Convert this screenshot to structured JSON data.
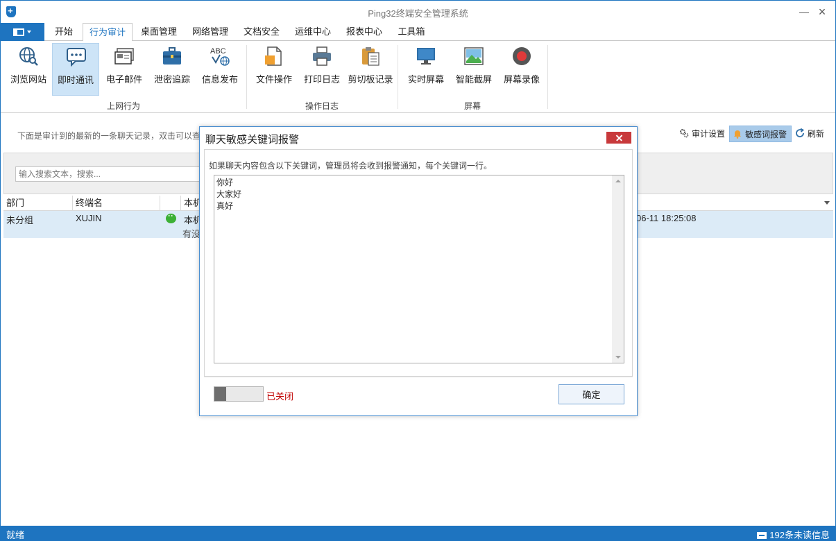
{
  "window": {
    "title": "Ping32终端安全管理系统"
  },
  "tabs": [
    {
      "label": "开始"
    },
    {
      "label": "行为审计",
      "active": true
    },
    {
      "label": "桌面管理"
    },
    {
      "label": "网络管理"
    },
    {
      "label": "文档安全"
    },
    {
      "label": "运维中心"
    },
    {
      "label": "报表中心"
    },
    {
      "label": "工具箱"
    }
  ],
  "ribbon": {
    "groups": [
      {
        "label": "上网行为"
      },
      {
        "label": "操作日志"
      },
      {
        "label": "屏幕"
      }
    ],
    "buttons": [
      {
        "label": "浏览网站",
        "icon": "globe-search-icon"
      },
      {
        "label": "即时通讯",
        "icon": "chat-bubble-icon",
        "selected": true
      },
      {
        "label": "电子邮件",
        "icon": "email-icon"
      },
      {
        "label": "泄密追踪",
        "icon": "briefcase-icon"
      },
      {
        "label": "信息发布",
        "icon": "abc-globe-icon"
      },
      {
        "label": "文件操作",
        "icon": "file-icon"
      },
      {
        "label": "打印日志",
        "icon": "printer-icon"
      },
      {
        "label": "剪切板记录",
        "icon": "clipboard-icon"
      },
      {
        "label": "实时屏幕",
        "icon": "monitor-icon"
      },
      {
        "label": "智能截屏",
        "icon": "picture-icon"
      },
      {
        "label": "屏幕录像",
        "icon": "record-icon"
      }
    ]
  },
  "toolbar": {
    "info": "下面是审计到的最新的一条聊天记录，双击可以查",
    "audit_settings": "审计设置",
    "sensitive_alert": "敏感词报警",
    "refresh": "刷新"
  },
  "search": {
    "placeholder": "输入搜索文本，搜索..."
  },
  "table": {
    "columns": [
      "部门",
      "终端名",
      "",
      "本机"
    ],
    "rows": [
      {
        "dept": "未分组",
        "terminal": "XUJIN",
        "app_icon": "wechat-icon",
        "local_line1": "本机",
        "local_line2": "有没",
        "time": "06-11 18:25:08"
      }
    ]
  },
  "statusbar": {
    "left": "就绪",
    "right": "192条未读信息"
  },
  "dialog": {
    "title": "聊天敏感关键词报警",
    "description": "如果聊天内容包含以下关键词，管理员将会收到报警通知，每个关键词一行。",
    "keywords": "你好\n大家好\n真好",
    "toggle_label": "已关闭",
    "ok_label": "确定"
  },
  "colors": {
    "accent": "#1e74c0",
    "selected_row": "#dcebf7",
    "close_red": "#c8393b",
    "off_text": "#c00000"
  }
}
